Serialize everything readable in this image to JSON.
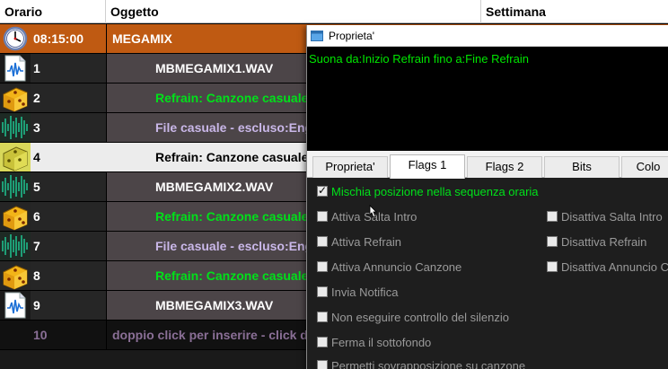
{
  "header": {
    "col_time": "Orario",
    "col_object": "Oggetto",
    "col_week": "Settimana"
  },
  "rows": [
    {
      "type": "time",
      "num": "08:15:00",
      "text": "MEGAMIX",
      "icon": "clock-icon"
    },
    {
      "type": "wave",
      "num": "1",
      "text": "MBMEGAMIX1.WAV",
      "color": "white",
      "icon": "wave-file-icon"
    },
    {
      "type": "dice",
      "num": "2",
      "text": "Refrain: Canzone casuale  -",
      "color": "green",
      "icon": "dice-icon"
    },
    {
      "type": "noise",
      "num": "3",
      "text": "File casuale  - escluso:Eng",
      "color": "lilac",
      "icon": "waveform-icon"
    },
    {
      "type": "dice-hl",
      "num": "4",
      "text": "Refrain: Canzone casuale  -",
      "color": "black",
      "icon": "dice-icon"
    },
    {
      "type": "noise",
      "num": "5",
      "text": "MBMEGAMIX2.WAV",
      "color": "white",
      "icon": "waveform-icon"
    },
    {
      "type": "dice",
      "num": "6",
      "text": "Refrain: Canzone casuale  -",
      "color": "green",
      "icon": "dice-icon"
    },
    {
      "type": "noise",
      "num": "7",
      "text": "File casuale  - escluso:Eng",
      "color": "lilac",
      "icon": "waveform-icon"
    },
    {
      "type": "dice",
      "num": "8",
      "text": "Refrain: Canzone casuale  -",
      "color": "green",
      "icon": "dice-icon"
    },
    {
      "type": "wave",
      "num": "9",
      "text": "MBMEGAMIX3.WAV",
      "color": "white",
      "icon": "wave-file-icon"
    },
    {
      "type": "add",
      "num": "10",
      "text": "doppio click per inserire - click de"
    }
  ],
  "dialog": {
    "title": "Proprieta'",
    "info": "Suona da:Inizio Refrain fino a:Fine Refrain",
    "tabs": [
      "Proprieta'",
      "Flags 1",
      "Flags 2",
      "Bits",
      "Colo"
    ],
    "active_tab": 1,
    "options_left": [
      {
        "label": "Mischia posizione nella sequenza oraria",
        "checked": true
      },
      {
        "label": "Attiva Salta Intro",
        "checked": false
      },
      {
        "label": "Attiva Refrain",
        "checked": false
      },
      {
        "label": "Attiva Annuncio Canzone",
        "checked": false
      },
      {
        "label": "Invia Notifica",
        "checked": false
      },
      {
        "label": "Non eseguire controllo del silenzio",
        "checked": false
      },
      {
        "label": "Ferma il sottofondo",
        "checked": false
      },
      {
        "label": "Permetti sovrapposizione su canzone",
        "checked": false
      }
    ],
    "options_right": [
      {
        "label": "Disattiva Salta Intro",
        "checked": false
      },
      {
        "label": "Disattiva Refrain",
        "checked": false
      },
      {
        "label": "Disattiva Annuncio C",
        "checked": false
      }
    ]
  },
  "colors": {
    "time_row": "#bf5a12",
    "green_text": "#00e11a",
    "lilac_text": "#c9b7e8",
    "row_bg": "#4c4548"
  }
}
